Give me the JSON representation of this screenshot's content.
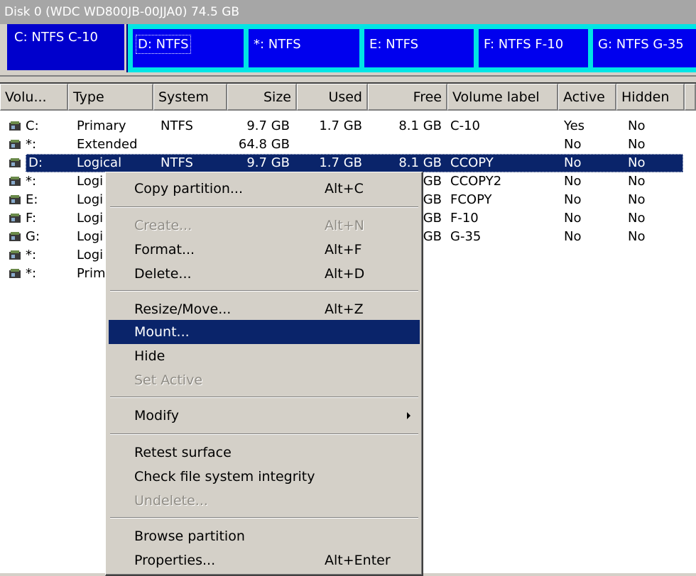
{
  "disk": {
    "title": "Disk 0 (WDC WD800JB-00JJA0) 74.5 GB",
    "partitions": [
      {
        "label": "C: NTFS C-10"
      },
      {
        "label": "D: NTFS"
      },
      {
        "label": "*: NTFS"
      },
      {
        "label": "E: NTFS"
      },
      {
        "label": "F: NTFS F-10"
      },
      {
        "label": "G: NTFS G-35"
      }
    ]
  },
  "table": {
    "columns": [
      "Volu...",
      "Type",
      "System",
      "Size",
      "Used",
      "Free",
      "Volume label",
      "Active",
      "Hidden"
    ],
    "rows": [
      {
        "vol": "C:",
        "type": "Primary",
        "system": "NTFS",
        "size": "9.7 GB",
        "used": "1.7 GB",
        "free": "8.1 GB",
        "label": "C-10",
        "active": "Yes",
        "hidden": "No"
      },
      {
        "vol": "*:",
        "type": "Extended",
        "system": "",
        "size": "64.8 GB",
        "used": "",
        "free": "",
        "label": "",
        "active": "No",
        "hidden": "No"
      },
      {
        "vol": "D:",
        "type": "Logical",
        "system": "NTFS",
        "size": "9.7 GB",
        "used": "1.7 GB",
        "free": "8.1 GB",
        "label": "CCOPY",
        "active": "No",
        "hidden": "No"
      },
      {
        "vol": "*:",
        "type": "Logi",
        "system": "",
        "size": "",
        "used": "",
        "free": "GB",
        "label": "CCOPY2",
        "active": "No",
        "hidden": "No"
      },
      {
        "vol": "E:",
        "type": "Logi",
        "system": "",
        "size": "",
        "used": "",
        "free": "GB",
        "label": "FCOPY",
        "active": "No",
        "hidden": "No"
      },
      {
        "vol": "F:",
        "type": "Logi",
        "system": "",
        "size": "",
        "used": "",
        "free": "GB",
        "label": "F-10",
        "active": "No",
        "hidden": "No"
      },
      {
        "vol": "G:",
        "type": "Logi",
        "system": "",
        "size": "",
        "used": "",
        "free": "GB",
        "label": "G-35",
        "active": "No",
        "hidden": "No"
      },
      {
        "vol": "*:",
        "type": "Logi",
        "system": "",
        "size": "",
        "used": "",
        "free": "",
        "label": "",
        "active": "",
        "hidden": ""
      },
      {
        "vol": "*:",
        "type": "Prim",
        "system": "",
        "size": "",
        "used": "",
        "free": "",
        "label": "",
        "active": "",
        "hidden": ""
      }
    ]
  },
  "menu": {
    "copy_partition": {
      "label": "Copy partition...",
      "shortcut": "Alt+C"
    },
    "create": {
      "label": "Create...",
      "shortcut": "Alt+N"
    },
    "format": {
      "label": "Format...",
      "shortcut": "Alt+F"
    },
    "delete": {
      "label": "Delete...",
      "shortcut": "Alt+D"
    },
    "resize_move": {
      "label": "Resize/Move...",
      "shortcut": "Alt+Z"
    },
    "mount": {
      "label": "Mount..."
    },
    "hide": {
      "label": "Hide"
    },
    "set_active": {
      "label": "Set Active"
    },
    "modify": {
      "label": "Modify"
    },
    "retest_surface": {
      "label": "Retest surface"
    },
    "check_fs": {
      "label": "Check file system integrity"
    },
    "undelete": {
      "label": "Undelete..."
    },
    "browse": {
      "label": "Browse partition"
    },
    "properties": {
      "label": "Properties...",
      "shortcut": "Alt+Enter"
    }
  },
  "colors": {
    "highlight": "#0a246a",
    "partition_primary": "#0000cc",
    "partition_ext_border": "#00e5e5",
    "disabled_text": "#8f8c85"
  },
  "icons": {
    "volume": "hard-drive-icon",
    "submenu": "triangle-right-icon"
  }
}
